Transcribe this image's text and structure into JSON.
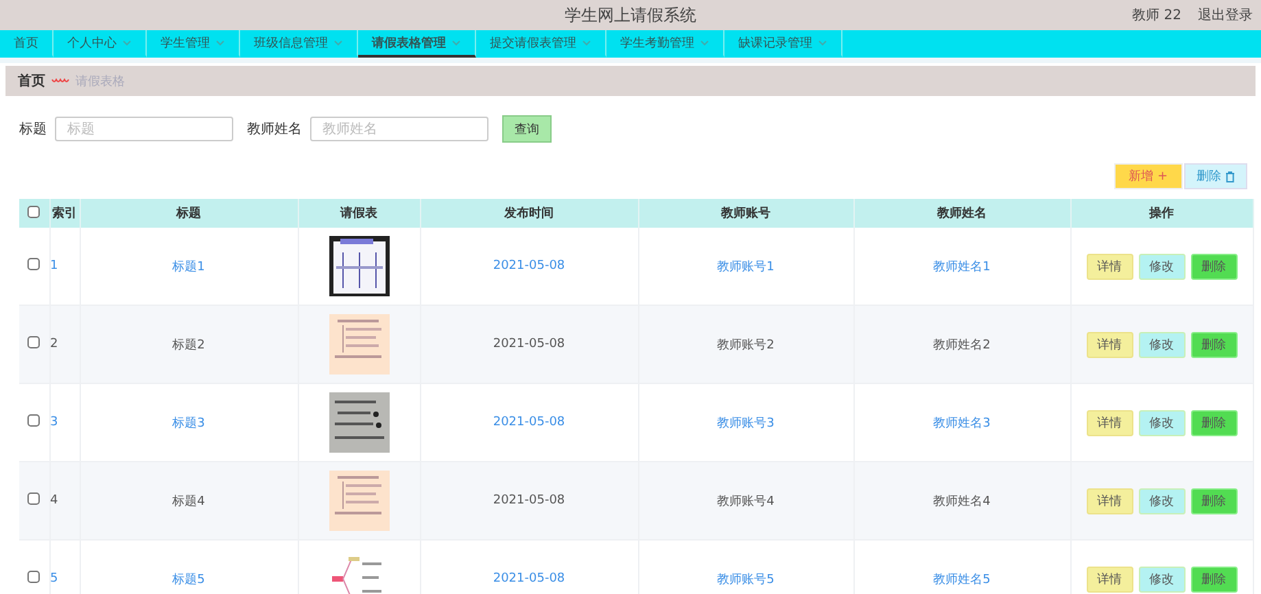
{
  "header": {
    "title": "学生网上请假系统",
    "user": "教师 22",
    "logout": "退出登录"
  },
  "menu": [
    {
      "label": "首页",
      "dropdown": false,
      "selected": false
    },
    {
      "label": "个人中心",
      "dropdown": true,
      "selected": false
    },
    {
      "label": "学生管理",
      "dropdown": true,
      "selected": false
    },
    {
      "label": "班级信息管理",
      "dropdown": true,
      "selected": false
    },
    {
      "label": "请假表格管理",
      "dropdown": true,
      "selected": true
    },
    {
      "label": "提交请假表管理",
      "dropdown": true,
      "selected": false
    },
    {
      "label": "学生考勤管理",
      "dropdown": true,
      "selected": false
    },
    {
      "label": "缺课记录管理",
      "dropdown": true,
      "selected": false
    }
  ],
  "breadcrumb": {
    "home": "首页",
    "current": "请假表格"
  },
  "search": {
    "fields": [
      {
        "label": "标题",
        "placeholder": "标题"
      },
      {
        "label": "教师姓名",
        "placeholder": "教师姓名"
      }
    ],
    "button": "查询"
  },
  "toolbar": {
    "add": "新增 +",
    "delete": "删除"
  },
  "table": {
    "all_checked": false,
    "columns": [
      "索引",
      "标题",
      "请假表",
      "发布时间",
      "教师账号",
      "教师姓名",
      "操作"
    ],
    "rows": [
      {
        "index": "1",
        "title": "标题1",
        "time": "2021-05-08",
        "account": "教师账号1",
        "name": "教师姓名1",
        "linked": true,
        "checked": false,
        "actions": [
          "详情",
          "修改",
          "删除"
        ]
      },
      {
        "index": "2",
        "title": "标题2",
        "time": "2021-05-08",
        "account": "教师账号2",
        "name": "教师姓名2",
        "linked": false,
        "checked": false,
        "actions": [
          "详情",
          "修改",
          "删除"
        ]
      },
      {
        "index": "3",
        "title": "标题3",
        "time": "2021-05-08",
        "account": "教师账号3",
        "name": "教师姓名3",
        "linked": true,
        "checked": false,
        "actions": [
          "详情",
          "修改",
          "删除"
        ]
      },
      {
        "index": "4",
        "title": "标题4",
        "time": "2021-05-08",
        "account": "教师账号4",
        "name": "教师姓名4",
        "linked": false,
        "checked": false,
        "actions": [
          "详情",
          "修改",
          "删除"
        ]
      },
      {
        "index": "5",
        "title": "标题5",
        "time": "2021-05-08",
        "account": "教师账号5",
        "name": "教师姓名5",
        "linked": true,
        "checked": false,
        "actions": [
          "详情",
          "修改",
          "删除"
        ]
      }
    ]
  }
}
